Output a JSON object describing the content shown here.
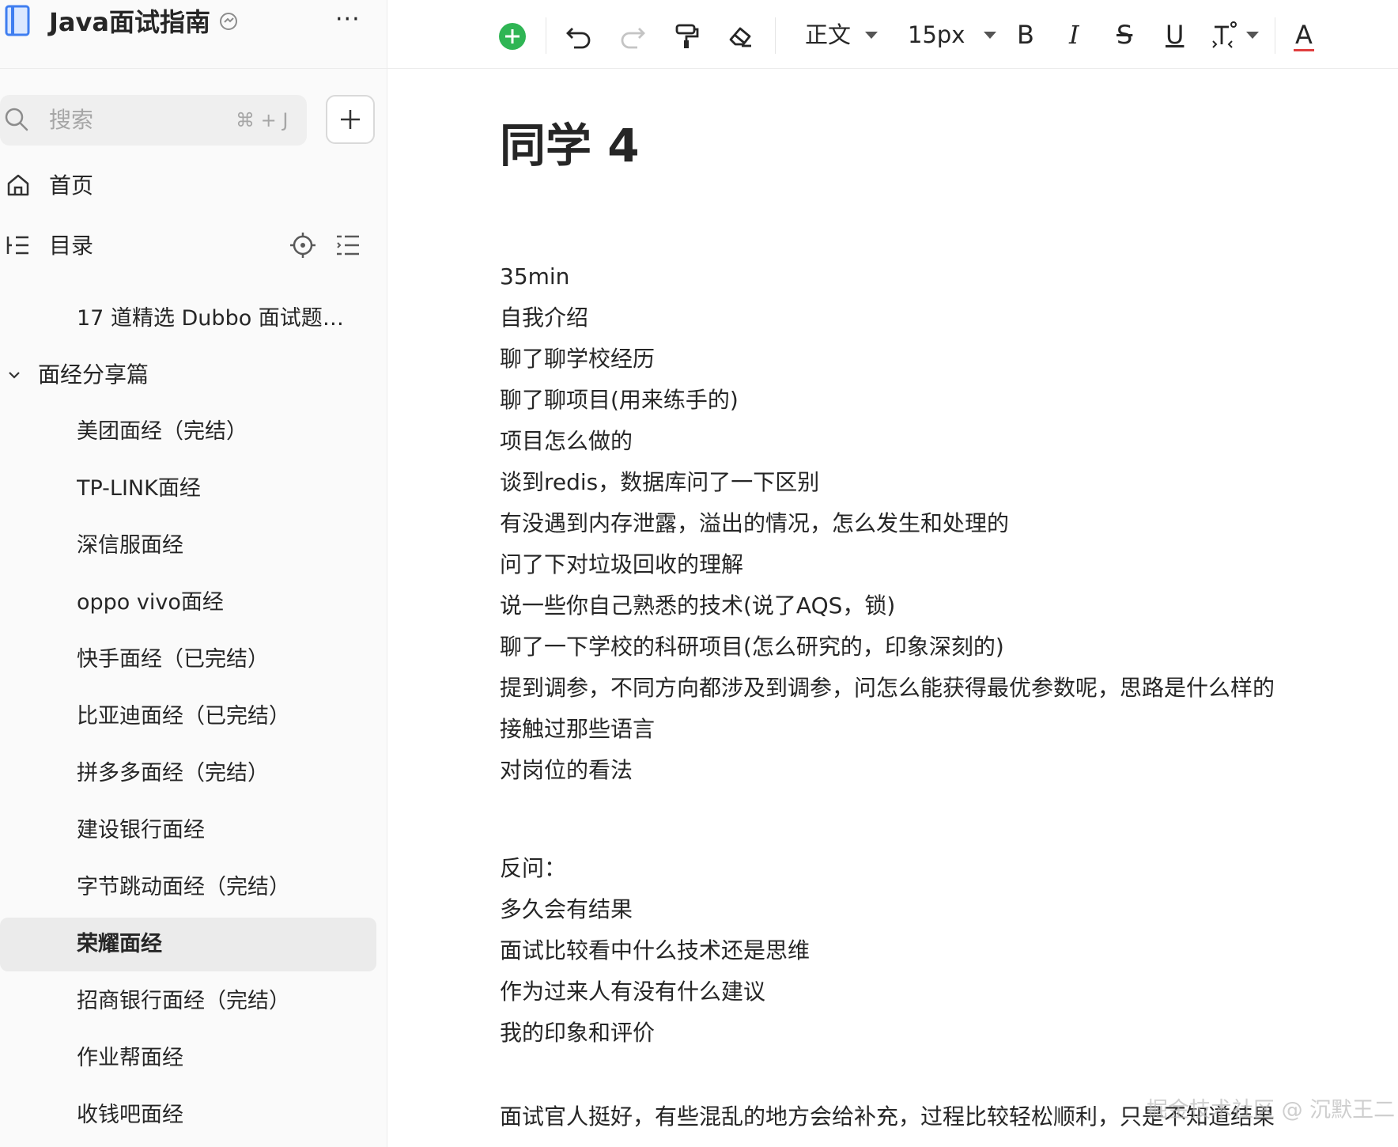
{
  "sidebar": {
    "title": "Java面试指南",
    "more": "···",
    "search": {
      "placeholder": "搜索",
      "shortcut": "⌘ + J"
    },
    "nav": {
      "home": "首页",
      "toc": "目录"
    },
    "top_item": "17 道精选 Dubbo 面试题👍…",
    "folder": "面经分享篇",
    "items": [
      "美团面经（完结）",
      "TP-LINK面经",
      "深信服面经",
      "oppo vivo面经",
      "快手面经（已完结）",
      "比亚迪面经（已完结）",
      "拼多多面经（完结）",
      "建设银行面经",
      "字节跳动面经（完结）",
      "荣耀面经",
      "招商银行面经（完结）",
      "作业帮面经",
      "收钱吧面经"
    ],
    "active_item": "荣耀面经"
  },
  "toolbar": {
    "paragraph_style": "正文",
    "font_size": "15px",
    "bold": "B",
    "italic": "I",
    "strike": "S",
    "underline": "U",
    "font_color": "A"
  },
  "colors": {
    "accent_green": "#2fb554",
    "font_color_red": "#e03e3e"
  },
  "document": {
    "title": "同学 4",
    "lines": [
      "35min",
      "自我介绍",
      "聊了聊学校经历",
      "聊了聊项目(用来练手的)",
      "项目怎么做的",
      "谈到redis，数据库问了一下区别",
      "有没遇到内存泄露，溢出的情况，怎么发生和处理的",
      "问了下对垃圾回收的理解",
      "说一些你自己熟悉的技术(说了AQS，锁)",
      "聊了一下学校的科研项目(怎么研究的，印象深刻的)",
      "提到调参，不同方向都涉及到调参，问怎么能获得最优参数呢，思路是什么样的",
      "接触过那些语言",
      "对岗位的看法"
    ],
    "lines2": [
      "反问：",
      "多久会有结果",
      "面试比较看中什么技术还是思维",
      "作为过来人有没有什么建议",
      "我的印象和评价"
    ],
    "closing": "面试官人挺好，有些混乱的地方会给补充，过程比较轻松顺利，只是不知道结果",
    "watermark": "掘金技术社区 @ 沉默王二"
  }
}
